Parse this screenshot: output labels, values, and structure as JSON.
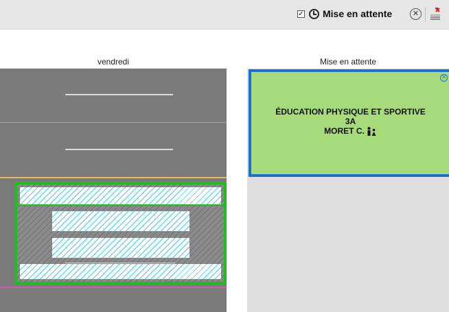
{
  "toolbar": {
    "checkbox_mark": "✓",
    "label": "Mise en attente",
    "close_symbol": "✕"
  },
  "columns": {
    "friday_header": "vendredi",
    "waiting_header": "Mise en attente"
  },
  "waiting_card": {
    "subject": "ÉDUCATION PHYSIQUE ET SPORTIVE",
    "class": "3A",
    "teacher": "MORET C.",
    "close_symbol": "✕",
    "background": "#a6da7a",
    "border": "#1c6fd0"
  },
  "colors": {
    "selection_border": "#1fbe1f",
    "hatch": "#3ecfe2",
    "grid_bg": "#7a7a7a"
  }
}
